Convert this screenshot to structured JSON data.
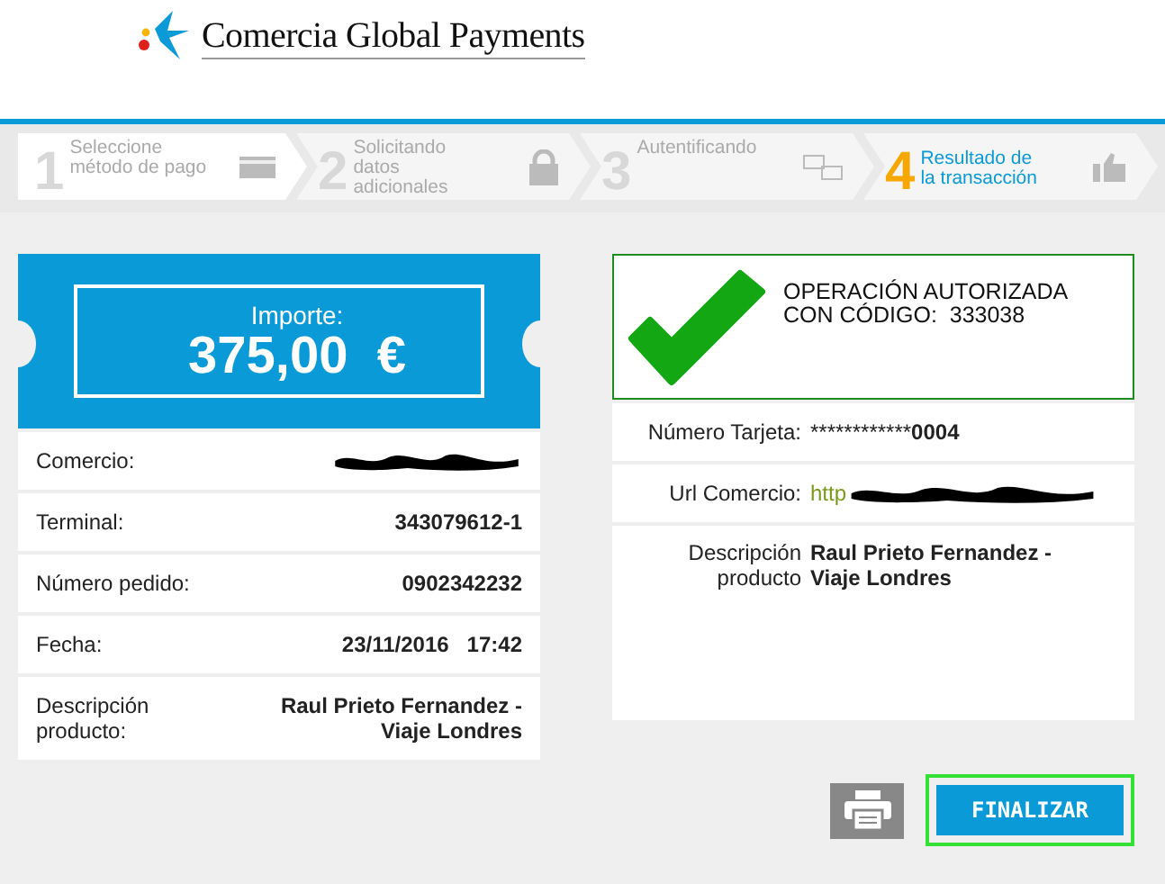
{
  "logo": {
    "text": "Comercia Global Payments"
  },
  "steps": [
    {
      "number": "1",
      "label": "Seleccione\nmétodo de pago",
      "selected": false
    },
    {
      "number": "2",
      "label": "Solicitando\ndatos\nadicionales",
      "selected": false
    },
    {
      "number": "3",
      "label": "Autentificando",
      "selected": false
    },
    {
      "number": "4",
      "label": "Resultado de\nla transacción",
      "selected": true
    }
  ],
  "amount": {
    "label": "Importe:",
    "value": "375,00  €"
  },
  "details": [
    {
      "kind": "redacted",
      "label": "Comercio:"
    },
    {
      "kind": "text",
      "label": "Terminal:",
      "value": "343079612-1"
    },
    {
      "kind": "text",
      "label": "Número pedido:",
      "value": "0902342232"
    },
    {
      "kind": "text",
      "label": "Fecha:",
      "value": "23/11/2016   17:42"
    },
    {
      "kind": "text",
      "label": "Descripción\nproducto:",
      "value": "Raul Prieto Fernandez -\nViaje Londres"
    }
  ],
  "result": {
    "status": "OPERACIÓN AUTORIZADA\nCON CÓDIGO:  333038"
  },
  "card_details": [
    {
      "kind": "card",
      "label": "Número Tarjeta:",
      "value": "************",
      "last_digits": "0004"
    },
    {
      "kind": "link",
      "label": "Url Comercio:",
      "value": "http"
    },
    {
      "kind": "text",
      "label": "Descripción\nproducto",
      "value": "**Raul Prieto Fernandez -\nViaje Londres**"
    }
  ],
  "actions": {
    "finish": "FINALIZAR",
    "focused": true
  }
}
